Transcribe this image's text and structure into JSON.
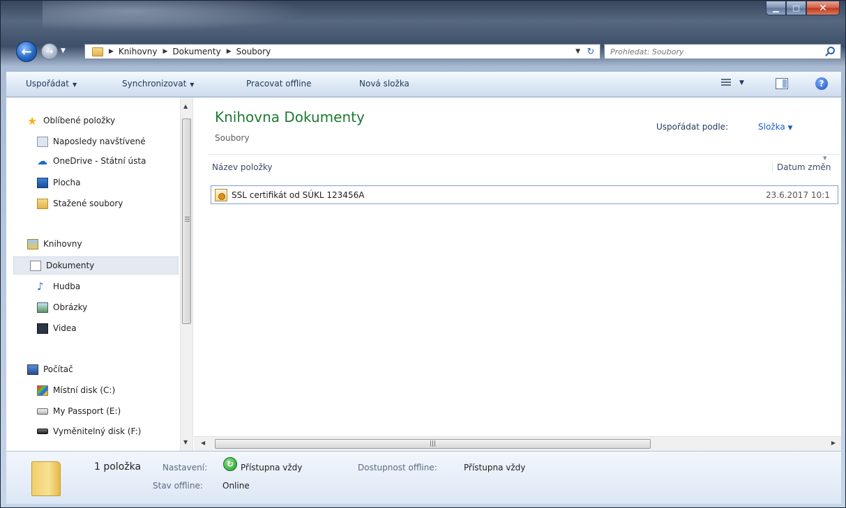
{
  "address": {
    "crumbs": [
      "Knihovny",
      "Dokumenty",
      "Soubory"
    ],
    "search_placeholder": "Prohledat: Soubory"
  },
  "toolbar": {
    "organize": "Uspořádat",
    "sync": "Synchronizovat",
    "offline": "Pracovat offline",
    "new_folder": "Nová složka"
  },
  "nav": {
    "favorites": "Oblíbené položky",
    "recent": "Naposledy navštívené",
    "onedrive": "OneDrive - Státní ústa",
    "desktop": "Plocha",
    "downloads": "Stažené soubory",
    "libraries": "Knihovny",
    "documents": "Dokumenty",
    "music": "Hudba",
    "pictures": "Obrázky",
    "videos": "Videa",
    "computer": "Počítač",
    "disk_c": "Místní disk (C:)",
    "disk_e": "My Passport (E:)",
    "disk_f": "Vyměnitelný disk (F:)"
  },
  "main": {
    "title": "Knihovna Dokumenty",
    "subtitle": "Soubory",
    "arrange_label": "Uspořádat podle:",
    "arrange_value": "Složka",
    "col_name": "Název položky",
    "col_date": "Datum změn",
    "files": [
      {
        "name": "SSL certifikát od SÚKL 123456A",
        "date": "23.6.2017 10:1"
      }
    ]
  },
  "status": {
    "count": "1 položka",
    "setting_label": "Nastavení:",
    "setting_value": "Přístupna vždy",
    "offline_avail_label": "Dostupnost offline:",
    "offline_avail_value": "Přístupna vždy",
    "offline_state_label": "Stav offline:",
    "offline_state_value": "Online"
  },
  "colors": {
    "title_green": "#1e7a33",
    "link_blue": "#1a5fc6"
  }
}
